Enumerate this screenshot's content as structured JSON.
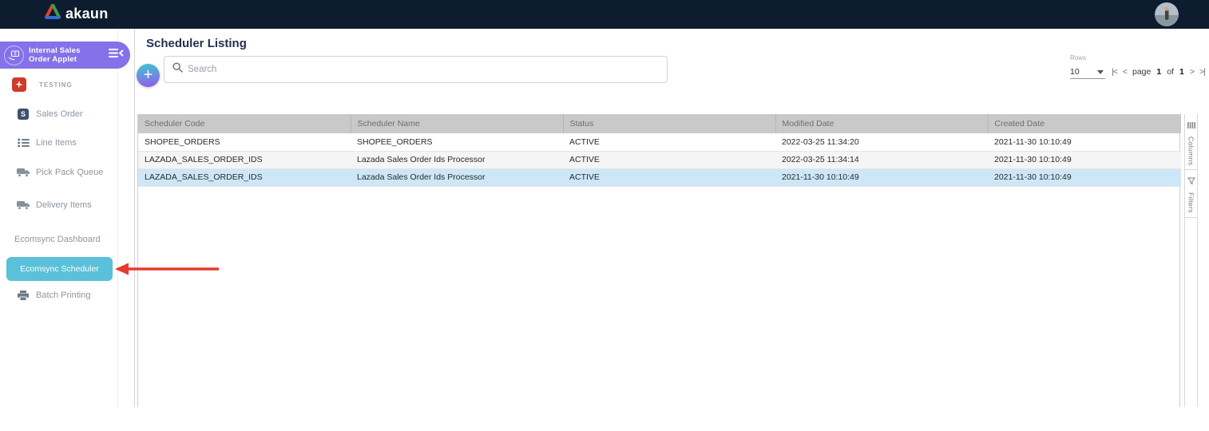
{
  "topbar": {
    "logo_text": "akaun"
  },
  "sidebar": {
    "applet": {
      "title_line1": "Internal Sales",
      "title_line2": "Order Applet"
    },
    "section_label": "TESTING",
    "items": [
      {
        "label": "Sales Order"
      },
      {
        "label": "Line Items"
      },
      {
        "label": "Pick Pack Queue"
      },
      {
        "label": "Delivery Items"
      },
      {
        "label": "Ecomsync Dashboard"
      },
      {
        "label": "Ecomsync Scheduler",
        "active": true
      },
      {
        "label": "Batch Printing"
      }
    ]
  },
  "main": {
    "title": "Scheduler Listing",
    "search_placeholder": "Search",
    "rows_label": "Rows",
    "rows_value": "10",
    "pagination": {
      "first": "|<",
      "prev": "<",
      "page_word": "page",
      "current": "1",
      "of_word": "of",
      "total": "1",
      "next": ">",
      "last": ">|"
    },
    "table": {
      "columns": [
        "Scheduler Code",
        "Scheduler Name",
        "Status",
        "Modified Date",
        "Created Date"
      ],
      "rows": [
        [
          "SHOPEE_ORDERS",
          "SHOPEE_ORDERS",
          "ACTIVE",
          "2022-03-25 11:34:20",
          "2021-11-30 10:10:49"
        ],
        [
          "LAZADA_SALES_ORDER_IDS",
          "Lazada Sales Order Ids Processor",
          "ACTIVE",
          "2022-03-25 11:34:14",
          "2021-11-30 10:10:49"
        ],
        [
          "LAZADA_SALES_ORDER_IDS",
          "Lazada Sales Order Ids Processor",
          "ACTIVE",
          "2021-11-30 10:10:49",
          "2021-11-30 10:10:49"
        ]
      ],
      "selected_row_index": 2
    },
    "side_tabs": [
      {
        "label": "Columns"
      },
      {
        "label": "Filters"
      }
    ]
  },
  "colors": {
    "topbar_bg": "#0d1c2e",
    "accent_purple": "#8571e9",
    "accent_teal": "#5bc0d9",
    "selected_row": "#cde7f8",
    "arrow_red": "#e63b2c",
    "testing_icon_red": "#cf3a2a"
  }
}
